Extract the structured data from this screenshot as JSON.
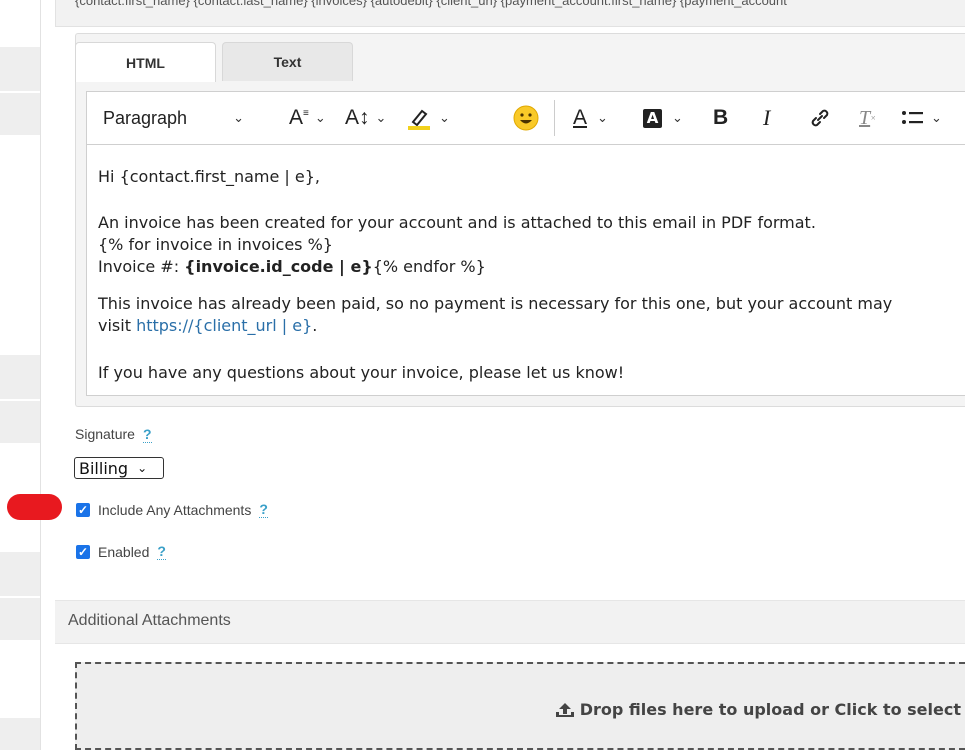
{
  "variables_line": "{contact.first_name} {contact.last_name} {invoices} {autodebit} {client_url} {payment_account.first_name} {payment_account",
  "editor": {
    "tabs": [
      {
        "label": "HTML",
        "active": true
      },
      {
        "label": "Text",
        "active": false
      }
    ],
    "toolbar": {
      "block_format": "Paragraph",
      "font_family_icon": "font-family-icon",
      "font_size_icon": "font-size-icon",
      "highlight_icon": "highlighter-icon",
      "emoji_icon": "emoji-icon",
      "text_color_icon": "text-color-icon",
      "bg_color_icon": "background-color-icon",
      "bold": "B",
      "italic": "I",
      "link_icon": "link-icon",
      "clear_format": "T",
      "list_icon": "bulleted-list-icon"
    },
    "content": {
      "greeting": "Hi {contact.first_name | e},",
      "p1_line1": "An invoice has been created for your account and is attached to this email in PDF format.",
      "p1_line2": "{% for invoice in invoices %}",
      "p1_line3_prefix": "Invoice #: ",
      "p1_line3_bold": "{invoice.id_code | e}",
      "p1_line3_suffix": "{% endfor %}",
      "p2_line1": "This invoice has already been paid, so no payment is necessary for this one, but your account may",
      "p2_line2_prefix": "visit ",
      "p2_link": "https://{client_url | e}",
      "p2_line2_suffix": ".",
      "p3": "If you have any questions about your invoice, please let us know!"
    }
  },
  "signature": {
    "label": "Signature",
    "help": "?",
    "selected": "Billing"
  },
  "include_attachments": {
    "label": "Include Any Attachments",
    "checked": true,
    "help": "?"
  },
  "enabled": {
    "label": "Enabled",
    "checked": true,
    "help": "?"
  },
  "additional_attachments": {
    "title": "Additional Attachments",
    "drop_text": "Drop files here to upload or Click to select"
  },
  "colors": {
    "checkbox": "#1a73e8",
    "marker": "#e8191f",
    "link": "#2a6fa8",
    "help": "#3aa0c8"
  }
}
